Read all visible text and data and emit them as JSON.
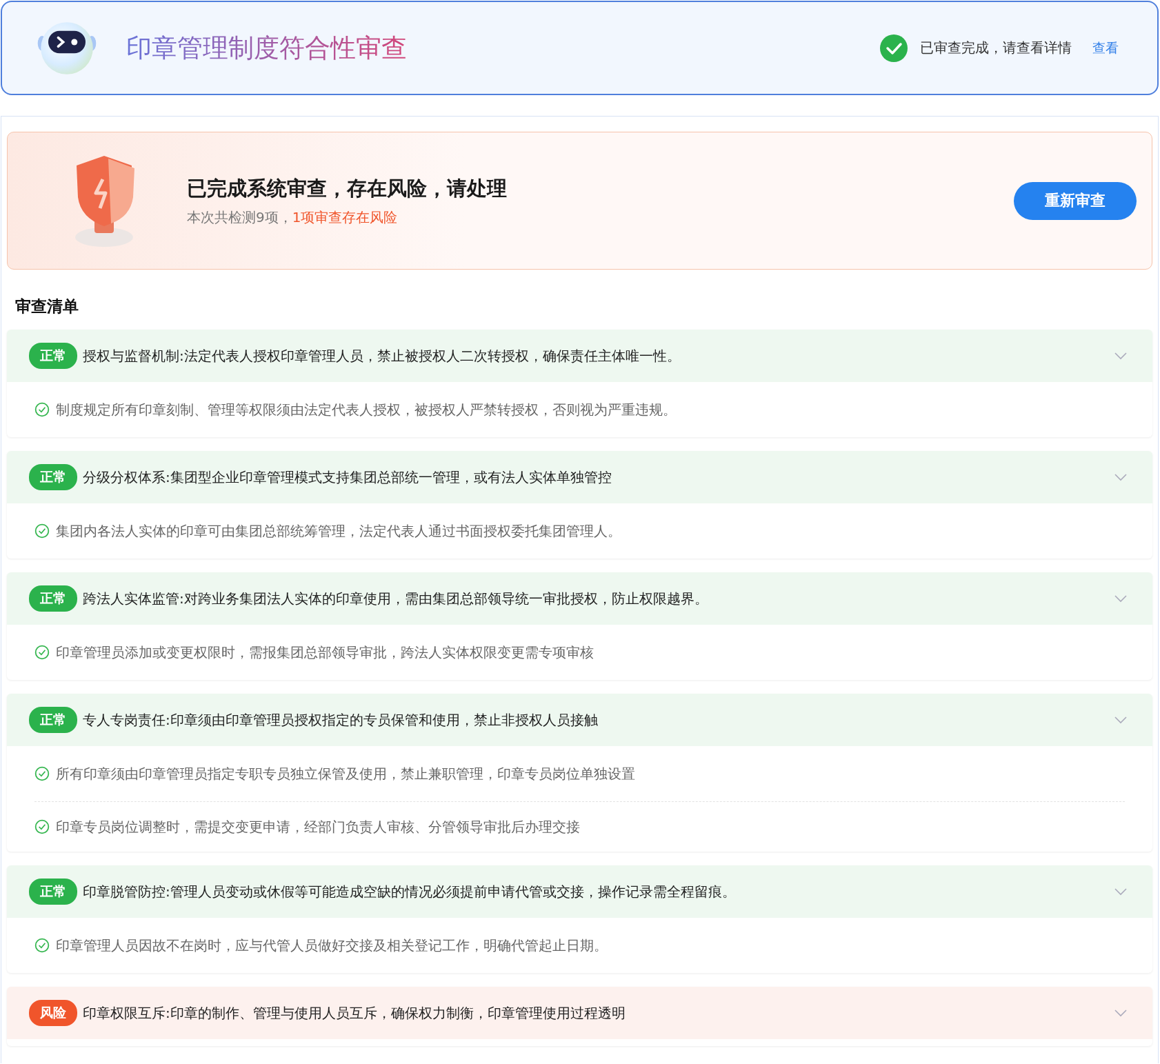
{
  "header": {
    "title": "印章管理制度符合性审查",
    "status_text": "已审查完成，请查看详情",
    "link": "查看"
  },
  "banner": {
    "title": "已完成系统审查，存在风险，请处理",
    "summary": "本次共检测9项，",
    "risk_summary": "1项审查存在风险",
    "button": "重新审查"
  },
  "checklist": {
    "title": "审查清单",
    "items": [
      {
        "kind": "normal",
        "badge": "正常",
        "title": "授权与监督机制:法定代表人授权印章管理人员，禁止被授权人二次转授权，确保责任主体唯一性。",
        "points": [
          "制度规定所有印章刻制、管理等权限须由法定代表人授权，被授权人严禁转授权，否则视为严重违规。"
        ]
      },
      {
        "kind": "normal",
        "badge": "正常",
        "title": "分级分权体系:集团型企业印章管理模式支持集团总部统一管理，或有法人实体单独管控",
        "points": [
          "集团内各法人实体的印章可由集团总部统筹管理，法定代表人通过书面授权委托集团管理人。"
        ]
      },
      {
        "kind": "normal",
        "badge": "正常",
        "title": "跨法人实体监管:对跨业务集团法人实体的印章使用，需由集团总部领导统一审批授权，防止权限越界。",
        "points": [
          "印章管理员添加或变更权限时，需报集团总部领导审批，跨法人实体权限变更需专项审核"
        ]
      },
      {
        "kind": "normal",
        "badge": "正常",
        "title": "专人专岗责任:印章须由印章管理员授权指定的专员保管和使用，禁止非授权人员接触",
        "points": [
          "所有印章须由印章管理员指定专职专员独立保管及使用，禁止兼职管理，印章专员岗位单独设置",
          "印章专员岗位调整时，需提交变更申请，经部门负责人审核、分管领导审批后办理交接"
        ]
      },
      {
        "kind": "normal",
        "badge": "正常",
        "title": "印章脱管防控:管理人员变动或休假等可能造成空缺的情况必须提前申请代管或交接，操作记录需全程留痕。",
        "points": [
          "印章管理人员因故不在岗时，应与代管人员做好交接及相关登记工作，明确代管起止日期。"
        ]
      },
      {
        "kind": "risk",
        "badge": "风险",
        "title": "印章权限互斥:印章的制作、管理与使用人员互斥，确保权力制衡，印章管理使用过程透明"
      }
    ]
  }
}
